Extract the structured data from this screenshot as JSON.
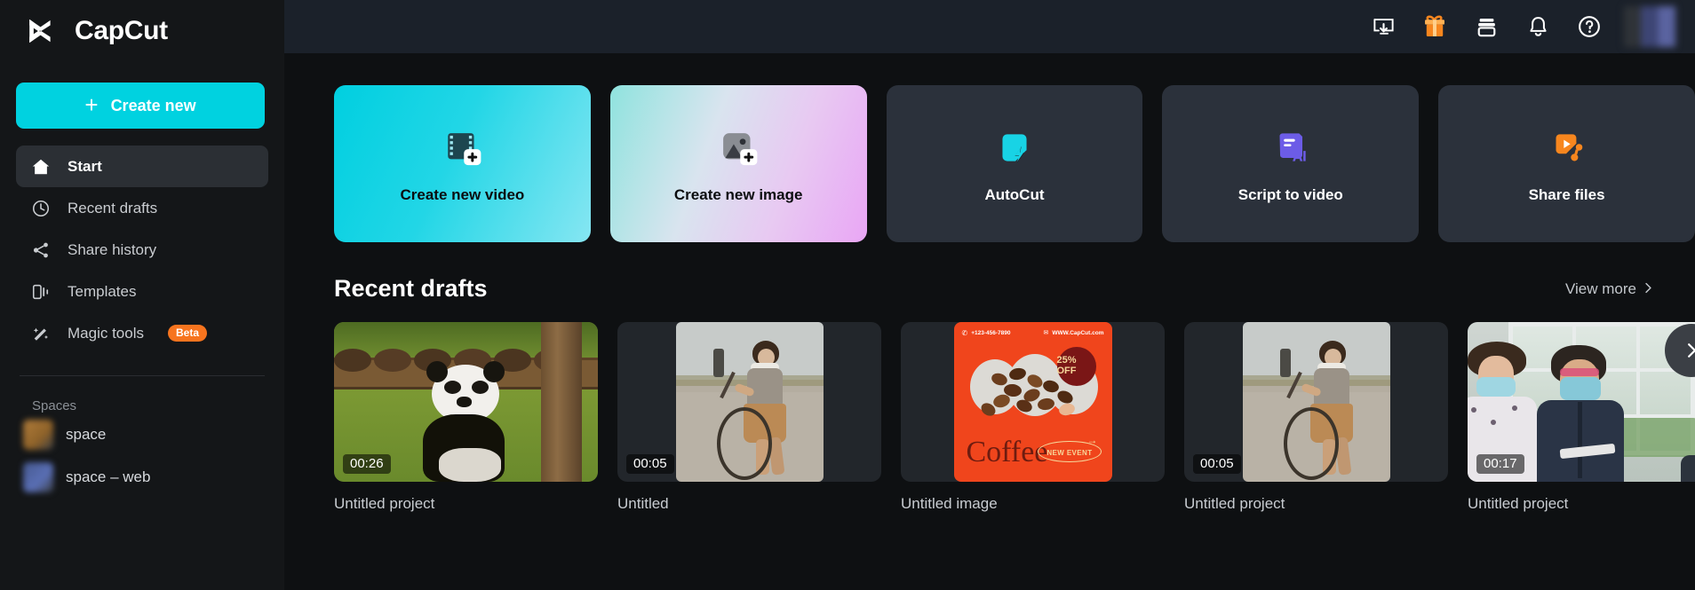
{
  "brand": {
    "name": "CapCut",
    "logo_icon": "capcut-logo-icon"
  },
  "sidebar": {
    "create_new": {
      "label": "Create new",
      "icon": "plus-icon",
      "color": "#00D2E0"
    },
    "items": [
      {
        "label": "Start",
        "icon": "home-icon",
        "active": true
      },
      {
        "label": "Recent drafts",
        "icon": "clock-icon",
        "active": false
      },
      {
        "label": "Share history",
        "icon": "share-icon",
        "active": false
      },
      {
        "label": "Templates",
        "icon": "templates-icon",
        "active": false
      },
      {
        "label": "Magic tools",
        "icon": "magic-wand-icon",
        "active": false,
        "badge": "Beta",
        "badge_color": "#F7741E"
      }
    ],
    "spaces_title": "Spaces",
    "spaces": [
      {
        "name": "space",
        "avatar_color": "#A9763A"
      },
      {
        "name": "space – web",
        "avatar_color": "#4A5E94"
      }
    ]
  },
  "topbar": {
    "buttons": [
      {
        "icon": "download-desktop-icon",
        "name": "download-app"
      },
      {
        "icon": "gift-icon",
        "name": "gift",
        "color": "#F7861E"
      },
      {
        "icon": "archive-box-icon",
        "name": "archive"
      },
      {
        "icon": "bell-icon",
        "name": "notifications"
      },
      {
        "icon": "help-circle-icon",
        "name": "help"
      }
    ],
    "avatar": {
      "icon": "avatar",
      "color": "#4A5488"
    }
  },
  "main": {
    "action_cards": [
      {
        "label": "Create new video",
        "icon": "film-plus-icon",
        "style": "video"
      },
      {
        "label": "Create new image",
        "icon": "image-plus-icon",
        "style": "image"
      },
      {
        "label": "AutoCut",
        "icon": "autocut-icon",
        "style": "dark"
      },
      {
        "label": "Script to video",
        "icon": "script-ai-icon",
        "style": "dark"
      },
      {
        "label": "Share files",
        "icon": "share-files-icon",
        "style": "dark"
      }
    ],
    "drafts_section": {
      "title": "Recent drafts",
      "view_more": "View more",
      "view_more_icon": "chevron-right-icon",
      "next_icon": "chevron-right-icon"
    },
    "drafts": [
      {
        "name": "Untitled project",
        "duration": "00:26",
        "thumb": "panda",
        "orientation": "landscape"
      },
      {
        "name": "Untitled",
        "duration": "00:05",
        "thumb": "girl-hoop",
        "orientation": "portrait"
      },
      {
        "name": "Untitled image",
        "duration": "",
        "thumb": "coffee-poster",
        "orientation": "square"
      },
      {
        "name": "Untitled project",
        "duration": "00:05",
        "thumb": "girl-hoop",
        "orientation": "portrait"
      },
      {
        "name": "Untitled project",
        "duration": "00:17",
        "thumb": "meeting",
        "orientation": "landscape"
      }
    ],
    "coffee_poster": {
      "phone": "+123-456-7890",
      "website": "WWW.CapCut.com",
      "discount": "25% OFF",
      "title": "Coffee",
      "tag": "NEW EVENT"
    }
  }
}
